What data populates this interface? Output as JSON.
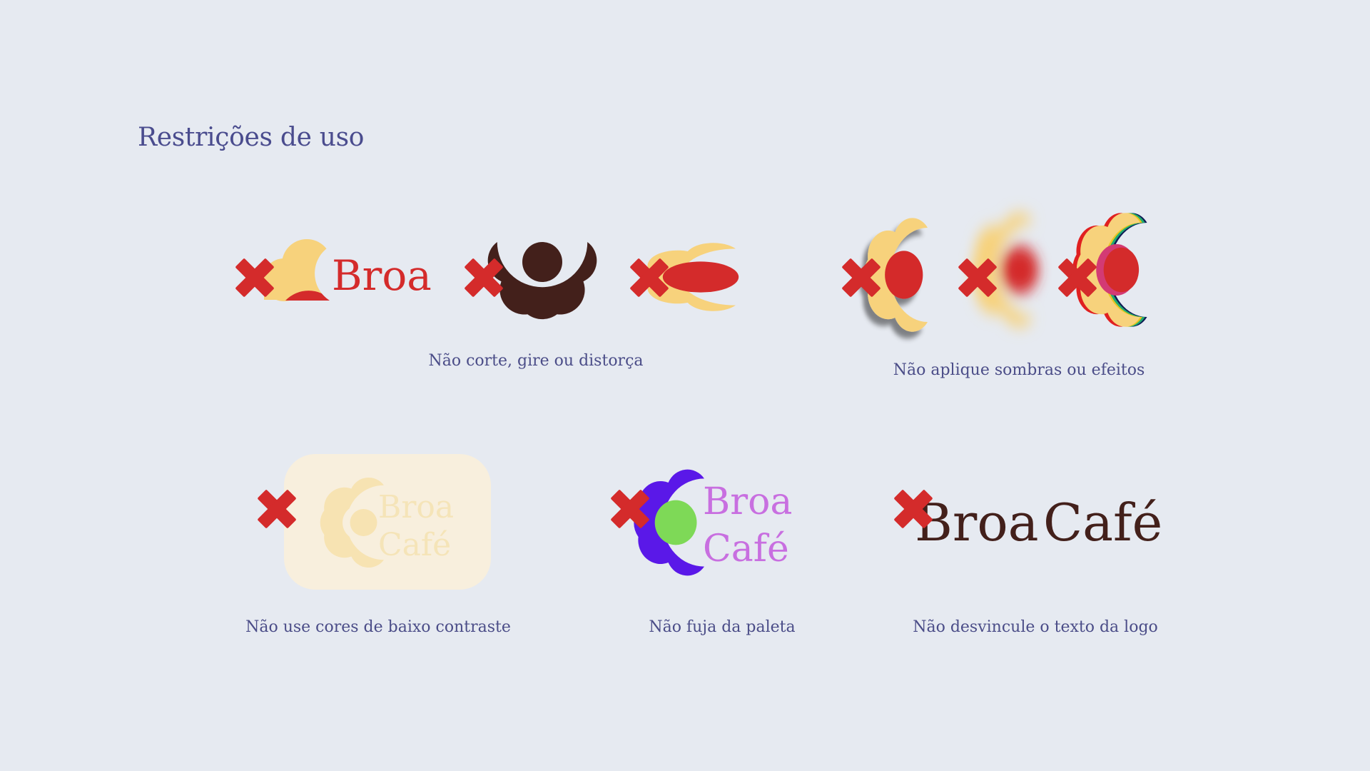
{
  "page": {
    "title": "Restrições de uso"
  },
  "captions": {
    "crop": "Não corte, gire ou distorça",
    "effects": "Não aplique sombras ou efeitos",
    "contrast": "Não use cores de baixo contraste",
    "palette": "Não fuja da paleta",
    "unlink": "Não desvincule o texto da logo"
  },
  "wordmarks": {
    "broa": "Broa",
    "cafe": "Café",
    "separate_broa": "Broa",
    "separate_cafe": "Café"
  },
  "colors": {
    "background": "#e6eaf1",
    "heading": "#4a4c8e",
    "brand_red": "#d42b2b",
    "brand_yellow": "#f7d27c",
    "brand_brown": "#43201b",
    "prohibit_cross": "#d42b2b",
    "pale_yellow": "#f8efdd",
    "off_palette_purple": "#5a18e8",
    "off_palette_green": "#7ed957",
    "off_palette_lilac": "#c86fe0"
  },
  "icons": [
    "prohibited-cross-icon",
    "broa-flower-logo"
  ]
}
